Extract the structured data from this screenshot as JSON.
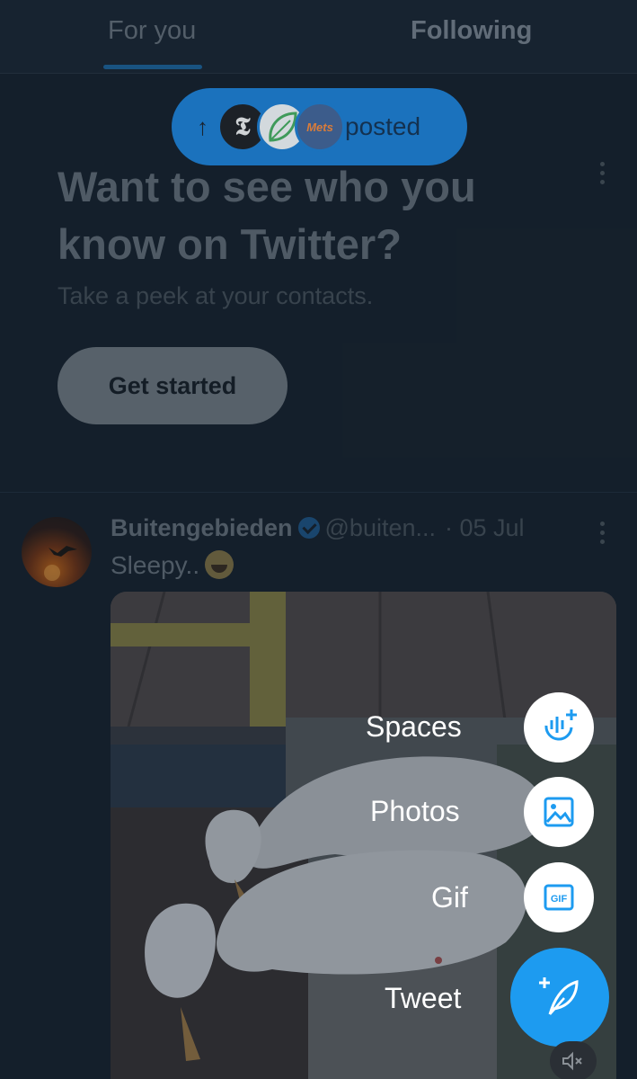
{
  "tabs": {
    "for_you": "For you",
    "following": "Following"
  },
  "new_posts_pill": {
    "arrow": "↑",
    "avatar_nyt": "𝕿",
    "avatar_mets": "Mets",
    "label": "posted"
  },
  "promo": {
    "title": "Want to see who you know on Twitter?",
    "subtitle": "Take a peek at your contacts.",
    "button": "Get started"
  },
  "tweet": {
    "name": "Buitengebieden",
    "handle": "@buiten...",
    "date": "· 05 Jul",
    "text": "Sleepy.."
  },
  "fab_menu": {
    "spaces": "Spaces",
    "photos": "Photos",
    "gif": "Gif",
    "tweet": "Tweet"
  },
  "colors": {
    "accent": "#1d9bf0",
    "background": "#15202b"
  }
}
